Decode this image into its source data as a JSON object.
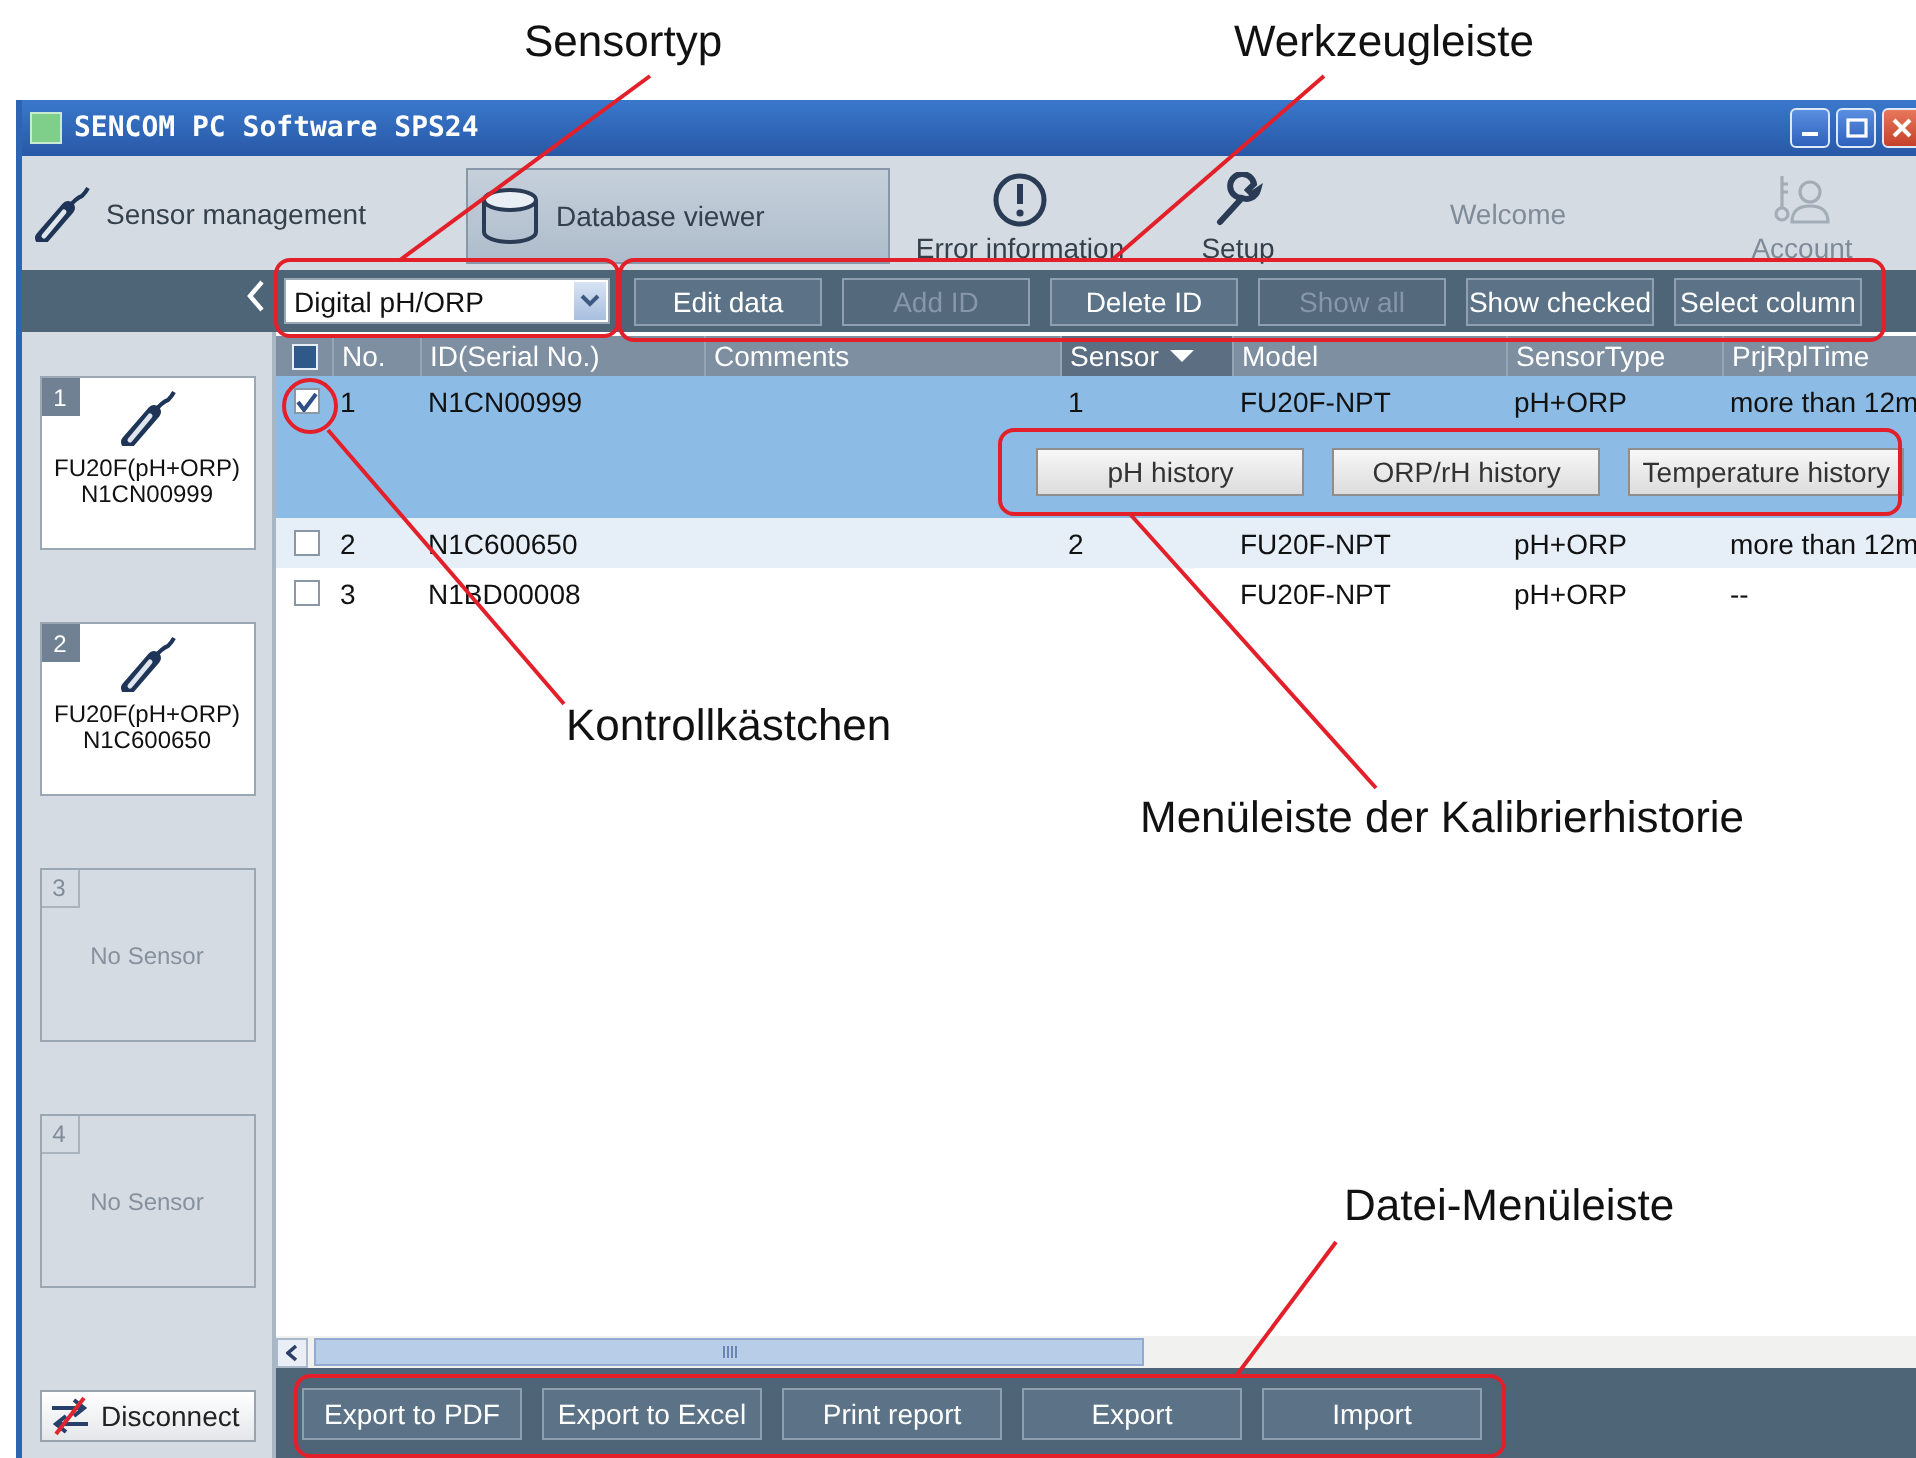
{
  "window": {
    "title": "SENCOM PC Software SPS24"
  },
  "nav": [
    {
      "label": "Sensor management",
      "kind": "probe",
      "selected": false,
      "disabled": false
    },
    {
      "label": "Database viewer",
      "kind": "database",
      "selected": true,
      "disabled": false
    },
    {
      "label": "Error information",
      "kind": "alert",
      "selected": false,
      "disabled": false
    },
    {
      "label": "Setup",
      "kind": "wrench",
      "selected": false,
      "disabled": false
    },
    {
      "label": "Welcome",
      "kind": "text",
      "selected": false,
      "disabled": true
    },
    {
      "label": "Account",
      "kind": "account",
      "selected": false,
      "disabled": true
    }
  ],
  "sensor_type": {
    "value": "Digital pH/ORP"
  },
  "toolbar": [
    {
      "label": "Edit data",
      "disabled": false
    },
    {
      "label": "Add ID",
      "disabled": true
    },
    {
      "label": "Delete ID",
      "disabled": false
    },
    {
      "label": "Show all",
      "disabled": true
    },
    {
      "label": "Show checked",
      "disabled": false
    },
    {
      "label": "Select column",
      "disabled": false
    }
  ],
  "sidebar": {
    "slots": [
      {
        "number": "1",
        "kind": "sensor",
        "name": "FU20F(pH+ORP)",
        "serial": "N1CN00999"
      },
      {
        "number": "2",
        "kind": "sensor",
        "name": "FU20F(pH+ORP)",
        "serial": "N1C600650"
      },
      {
        "number": "3",
        "kind": "empty",
        "label": "No Sensor"
      },
      {
        "number": "4",
        "kind": "empty",
        "label": "No Sensor"
      }
    ],
    "disconnect": "Disconnect"
  },
  "table": {
    "all_checked": false,
    "columns": [
      {
        "label": "No.",
        "sorted": false
      },
      {
        "label": "ID(Serial No.)",
        "sorted": false
      },
      {
        "label": "Comments",
        "sorted": false
      },
      {
        "label": "Sensor",
        "sorted": true
      },
      {
        "label": "Model",
        "sorted": false
      },
      {
        "label": "SensorType",
        "sorted": false
      },
      {
        "label": "PrjRplTime",
        "sorted": false
      }
    ],
    "rows": [
      {
        "checked": true,
        "selected": true,
        "no": "1",
        "id": "N1CN00999",
        "sensor": "1",
        "model": "FU20F-NPT",
        "sensor_type": "pH+ORP",
        "prj_rpl_time": "more than 12m"
      },
      {
        "checked": false,
        "selected": false,
        "no": "2",
        "id": "N1C600650",
        "sensor": "2",
        "model": "FU20F-NPT",
        "sensor_type": "pH+ORP",
        "prj_rpl_time": "more than 12m"
      },
      {
        "checked": false,
        "selected": false,
        "no": "3",
        "id": "N1BD00008",
        "model": "FU20F-NPT",
        "sensor_type": "pH+ORP",
        "prj_rpl_time": "--"
      }
    ],
    "history_buttons": [
      "pH history",
      "ORP/rH history",
      "Temperature history"
    ]
  },
  "file_bar": [
    "Export to PDF",
    "Export to Excel",
    "Print report",
    "Export",
    "Import"
  ],
  "annotations": [
    {
      "label": "Sensortyp",
      "kind": "box"
    },
    {
      "label": "Werkzeugleiste",
      "kind": "box"
    },
    {
      "label": "Kontrollkästchen",
      "kind": "circle"
    },
    {
      "label": "Menüleiste der Kalibrierhistorie",
      "kind": "box"
    },
    {
      "label": "Datei-Menüleiste",
      "kind": "box"
    }
  ]
}
